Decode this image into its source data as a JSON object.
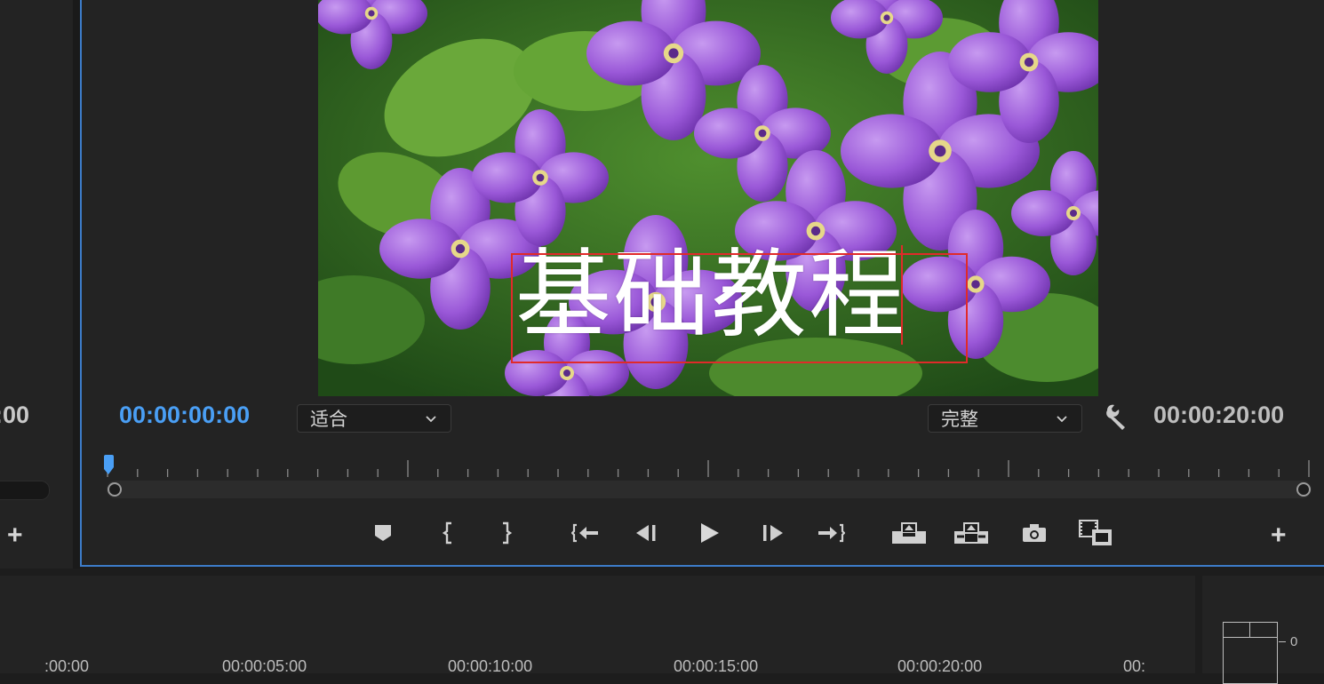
{
  "left_panel": {
    "timecode": ":00",
    "add_label": "+"
  },
  "preview": {
    "title_text": "基础教程"
  },
  "monitor": {
    "current_timecode": "00:00:00:00",
    "end_timecode": "00:00:20:00",
    "fit_dropdown": {
      "selected": "适合"
    },
    "resolution_dropdown": {
      "selected": "完整"
    },
    "add_label": "+",
    "playhead_position": 0,
    "colors": {
      "accent": "#4a9ff5",
      "panel_border": "#3d7cc9",
      "title_box": "#e02a2a"
    },
    "controls": [
      {
        "name": "add-marker-button",
        "icon": "marker-icon"
      },
      {
        "name": "mark-in-button",
        "icon": "mark-in-icon"
      },
      {
        "name": "mark-out-button",
        "icon": "mark-out-icon"
      },
      {
        "name": "go-to-in-button",
        "icon": "go-to-in-icon"
      },
      {
        "name": "step-back-button",
        "icon": "step-back-icon"
      },
      {
        "name": "play-button",
        "icon": "play-icon"
      },
      {
        "name": "step-forward-button",
        "icon": "step-forward-icon"
      },
      {
        "name": "go-to-out-button",
        "icon": "go-to-out-icon"
      },
      {
        "name": "lift-button",
        "icon": "lift-icon"
      },
      {
        "name": "extract-button",
        "icon": "extract-icon"
      },
      {
        "name": "export-frame-button",
        "icon": "camera-icon"
      },
      {
        "name": "compare-view-button",
        "icon": "compare-view-icon"
      }
    ]
  },
  "timeline": {
    "ruler_labels": [
      ":00:00",
      "00:00:05:00",
      "00:00:10:00",
      "00:00:15:00",
      "00:00:20:00",
      "00:"
    ]
  },
  "audio_meter": {
    "zero_label": "0"
  }
}
